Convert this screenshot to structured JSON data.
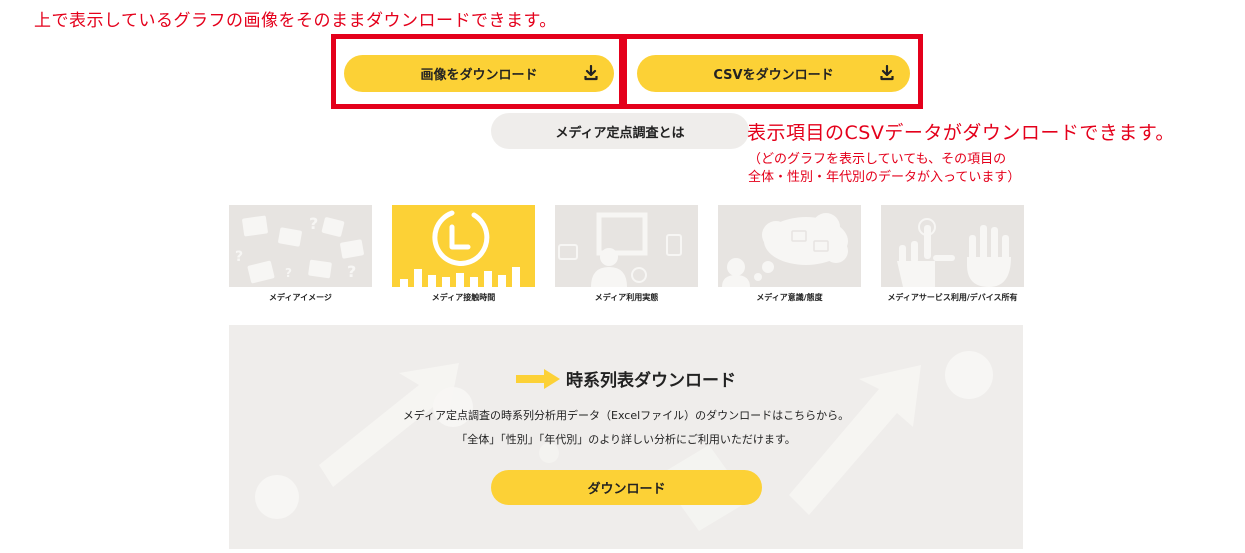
{
  "annotations": {
    "top": "上で表示しているグラフの画像をそのままダウンロードできます。",
    "right_title": "表示項目のCSVデータがダウンロードできます。",
    "right_note_line1": "（どのグラフを表示していても、その項目の",
    "right_note_line2": "全体・性別・年代別のデータが入っています）"
  },
  "downloads": {
    "image_label": "画像をダウンロード",
    "csv_label": "CSVをダウンロード",
    "icon": "download-icon"
  },
  "about_tab": "メディア定点調査とは",
  "categories": [
    {
      "label": "メディアイメージ",
      "icon": "question-cards-icon",
      "active": false
    },
    {
      "label": "メディア接触時間",
      "icon": "clock-icon",
      "active": true
    },
    {
      "label": "メディア利用実態",
      "icon": "person-screen-icon",
      "active": false
    },
    {
      "label": "メディア意識/態度",
      "icon": "thought-bubble-icon",
      "active": false
    },
    {
      "label": "メディアサービス利用/デバイス所有",
      "icon": "hands-icon",
      "active": false
    }
  ],
  "timeseries": {
    "title": "時系列表ダウンロード",
    "desc_line1": "メディア定点調査の時系列分析用データ（Excelファイル）のダウンロードはこちらから。",
    "desc_line2": "「全体」「性別」「年代別」のより詳しい分析にご利用いただけます。",
    "button_label": "ダウンロード"
  },
  "colors": {
    "accent": "#fcd136",
    "annotation": "#e4001b",
    "panel": "#efedeb",
    "tile": "#e7e4e1"
  }
}
